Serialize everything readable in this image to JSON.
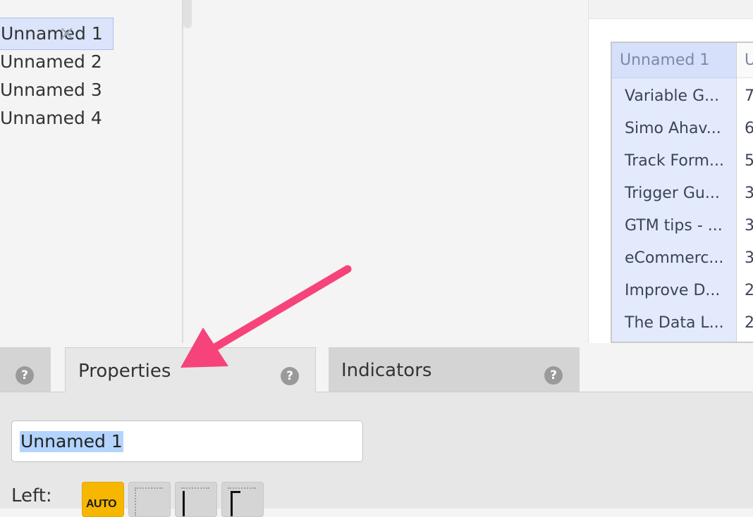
{
  "left_list": {
    "items": [
      {
        "label": "Unnamed 1",
        "selected": true
      },
      {
        "label": "Unnamed 2",
        "selected": false
      },
      {
        "label": "Unnamed 3",
        "selected": false
      },
      {
        "label": "Unnamed 4",
        "selected": false
      }
    ],
    "close_icon": "close-icon"
  },
  "table": {
    "headers": [
      "Unnamed 1",
      "U"
    ],
    "rows": [
      [
        "Variable G...",
        "7"
      ],
      [
        "Simo Ahav...",
        "6"
      ],
      [
        "Track Form...",
        "5"
      ],
      [
        "Trigger Gu...",
        "3"
      ],
      [
        "GTM tips - ...",
        "3"
      ],
      [
        "eCommerc...",
        "3"
      ],
      [
        "Improve D...",
        "2"
      ],
      [
        "The Data L...",
        "2"
      ]
    ]
  },
  "tabs": {
    "left_help": "?",
    "properties_label": "Properties",
    "properties_help": "?",
    "indicators_label": "Indicators",
    "indicators_help": "?"
  },
  "properties": {
    "name_value": "Unnamed 1",
    "left_label": "Left:",
    "auto_label": "AUTO"
  },
  "colors": {
    "accent_arrow": "#f6437a",
    "selection": "#dbe4fb",
    "auto_button": "#f7b700"
  }
}
